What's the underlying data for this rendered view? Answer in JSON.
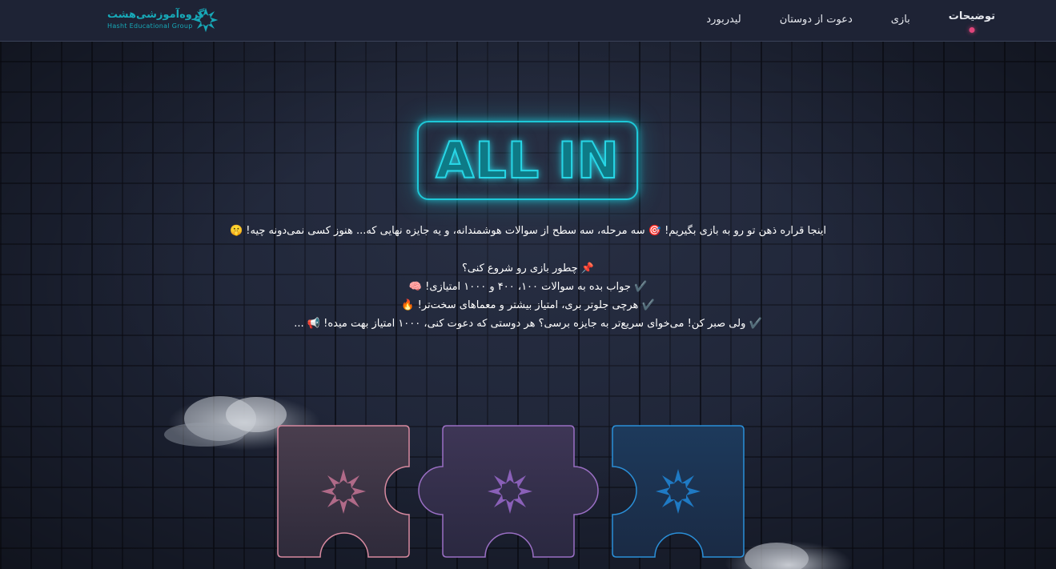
{
  "nav": {
    "items": [
      {
        "label": "توضیحات",
        "active": true
      },
      {
        "label": "بازی",
        "active": false
      },
      {
        "label": "دعوت از دوستان",
        "active": false
      },
      {
        "label": "لیدربورد",
        "active": false
      }
    ]
  },
  "logo": {
    "title": "گروه‌آموزشی‌هشت",
    "subtitle": "Hasht Educational Group",
    "icon": "hasht-logo-icon"
  },
  "hero": {
    "sign_text": "ALL IN",
    "intro": "اینجا قراره ذهن تو رو به بازی بگیریم! 🎯 سه مرحله، سه سطح از سوالات هوشمندانه، و یه جایزه نهایی که... هنوز کسی نمی‌دونه چیه! 🤫"
  },
  "how_to": {
    "title": "📌 چطور بازی رو شروع کنی؟",
    "lines": [
      "✔️ جواب بده به سوالات ۱۰۰، ۴۰۰ و ۱۰۰۰ امتیازی! 🧠",
      "✔️ هرچی جلوتر بری، امتیاز بیشتر و معماهای سخت‌تر! 🔥",
      "✔️ ولی صبر کن! می‌خوای سریع‌تر به جایزه برسی؟ هر دوستی که دعوت کنی، ۱۰۰۰ امتیاز بهت میده! 📢 ..."
    ]
  },
  "colors": {
    "accent": "#1ec8d8",
    "nav_dot": "#e0457b",
    "piece_pink": "#d88aa0",
    "piece_purple": "#9a6fc4",
    "piece_blue": "#2a8fd8"
  }
}
